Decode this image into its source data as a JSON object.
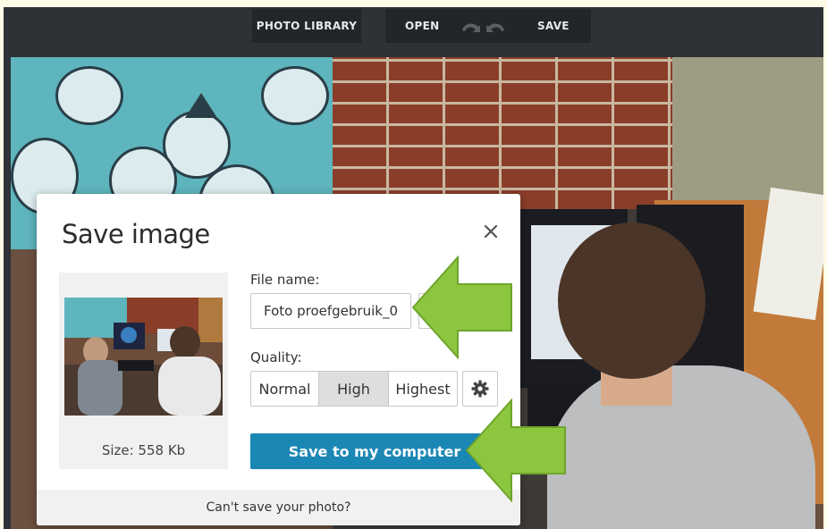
{
  "toolbar": {
    "photo_library_label": "PHOTO LIBRARY",
    "open_label": "OPEN",
    "undo_icon": "undo-icon",
    "redo_icon": "redo-icon",
    "save_label": "SAVE"
  },
  "dialog": {
    "title": "Save image",
    "close_icon": "close-icon",
    "preview": {
      "size_text": "Size: 558 Kb"
    },
    "file_name": {
      "label": "File name:",
      "value": "Foto proefgebruik_0("
    },
    "quality": {
      "label": "Quality:",
      "options": [
        "Normal",
        "High",
        "Highest"
      ],
      "selected": "High",
      "settings_icon": "gear-icon"
    },
    "save_button_label": "Save to my computer",
    "footer_link": "Can't save your photo?"
  },
  "annotations": {
    "arrow_color": "#8cc63f",
    "arrow_icon": "arrow-left-icon"
  },
  "colors": {
    "toolbar_bg": "#2e3236",
    "toolbar_button_bg": "#232629",
    "primary_button": "#1b87b5",
    "selected_option": "#dedede",
    "page_bg": "#fdfbe6"
  }
}
